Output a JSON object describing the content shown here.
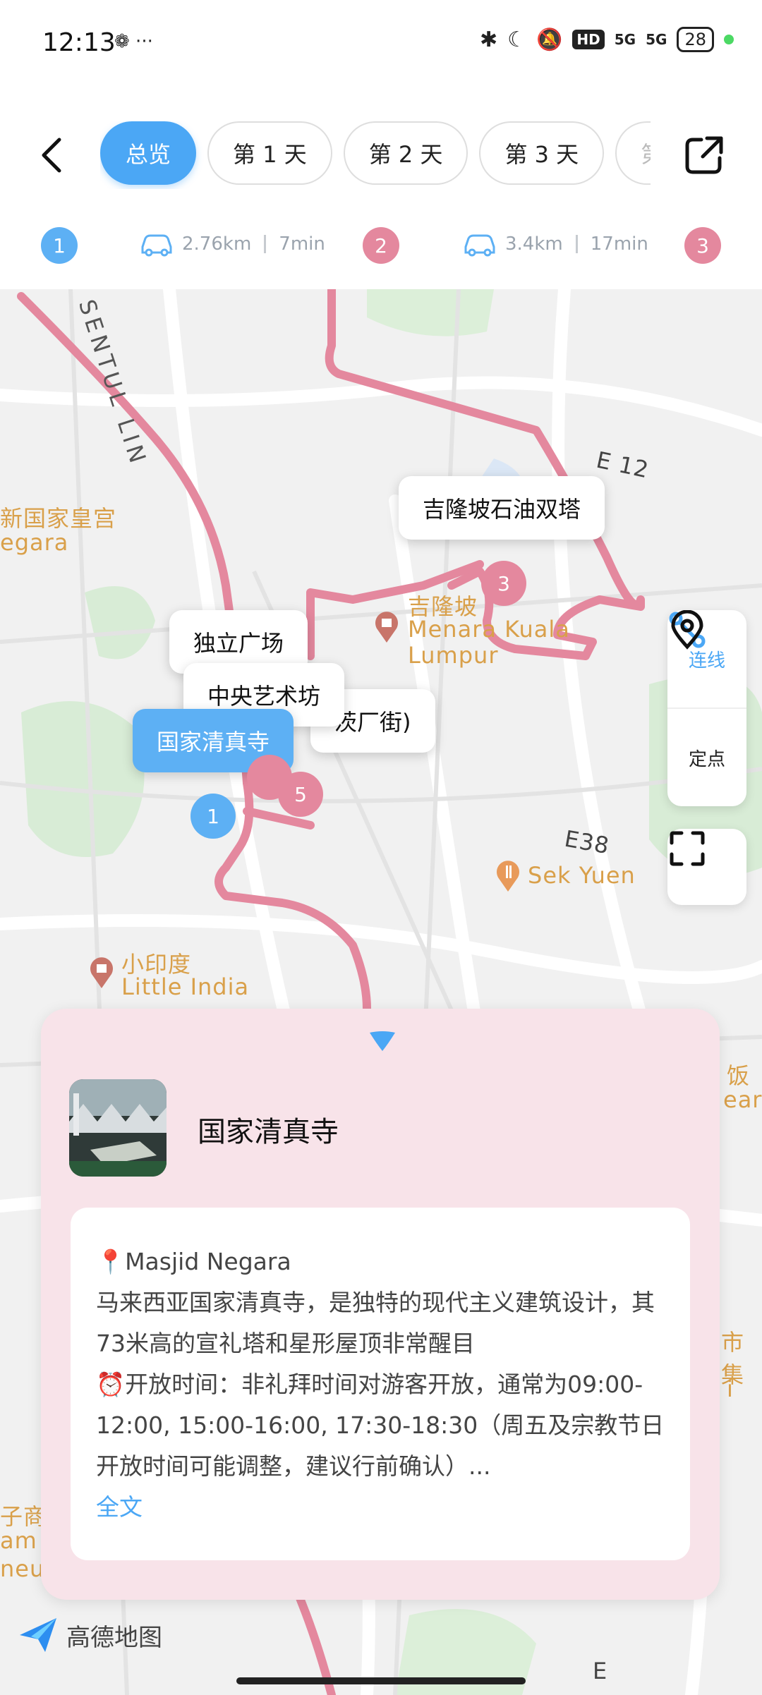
{
  "status": {
    "time": "12:13",
    "battery": "28",
    "hd": "HD",
    "net1": "5G",
    "net2": "5G"
  },
  "header": {
    "tabs": [
      "总览",
      "第 1 天",
      "第 2 天",
      "第 3 天",
      "第"
    ]
  },
  "route": {
    "points": [
      "1",
      "2",
      "3"
    ],
    "seg1": {
      "distance": "2.76km",
      "time": "7min"
    },
    "seg2": {
      "distance": "3.4km",
      "time": "17min"
    }
  },
  "tools": {
    "connect": "连线",
    "pin": "定点"
  },
  "map": {
    "labels": {
      "sentul": "SENTUL LIN",
      "istana1": "新国家皇宫",
      "istana2": "egara",
      "e12": "E 12",
      "klcc_cn": "吉隆坡",
      "klcc_en1": "Menara Kuala",
      "klcc_en2": "Lumpur",
      "e38": "E38",
      "sekyuen": "Sek Yuen",
      "li_cn": "小印度",
      "li_en": "Little India",
      "right1": "饭",
      "right2": "ear",
      "right3": "市集",
      "right4": "i",
      "left1": "子商",
      "left2": "am",
      "left3": "neu",
      "bottom_e": "E"
    },
    "bubbles": {
      "twin": "吉隆坡石油双塔",
      "merdeka": "独立广场",
      "central": "中央艺术坊",
      "petaling": "茨厂街)",
      "mosque": "国家清真寺"
    },
    "markers": {
      "m1": "1",
      "m3": "3",
      "m5": "5"
    }
  },
  "card": {
    "title": "国家清真寺",
    "location": "📍Masjid Negara",
    "desc": "马来西亚国家清真寺，是独特的现代主义建筑设计，其73米高的宣礼塔和星形屋顶非常醒目",
    "hours": "⏰开放时间：非礼拜时间对游客开放，通常为09:00-12:00, 15:00-16:00, 17:30-18:30（周五及宗教节日开放时间可能调整，建议行前确认）...",
    "more": "全文"
  },
  "watermark": "高德地图",
  "colors": {
    "accent": "#4ba7f5",
    "route": "#e4889e",
    "card_bg": "#f8e3e9"
  }
}
